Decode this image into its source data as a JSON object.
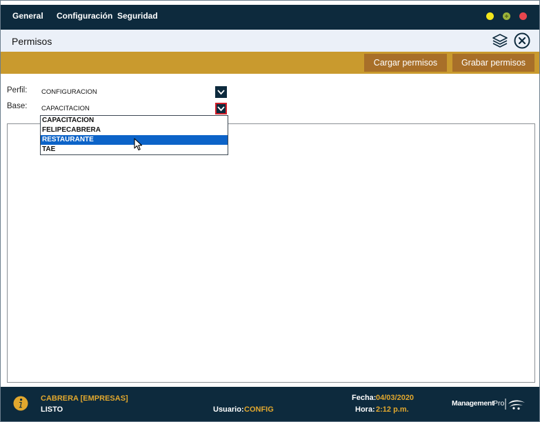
{
  "menu": {
    "items": [
      "General",
      "Configuración",
      "Seguridad"
    ]
  },
  "window": {
    "title": "Permisos"
  },
  "toolbar": {
    "load_label": "Cargar permisos",
    "save_label": "Grabar permisos"
  },
  "form": {
    "perfil_label": "Perfil:",
    "perfil_value": "CONFIGURACION",
    "base_label": "Base:",
    "base_value": "CAPACITACION",
    "base_options": [
      "CAPACITACION",
      "FELIPECABRERA",
      "RESTAURANTE",
      "TAE"
    ],
    "highlighted_option": "RESTAURANTE"
  },
  "status": {
    "company": "CABRERA [EMPRESAS]",
    "state": "LISTO",
    "user_label": "Usuario:",
    "user_value": "CONFIG",
    "date_label": "Fecha:",
    "date_value": "04/03/2020",
    "time_label": "Hora:",
    "time_value": "2:12 p.m.",
    "brand_a": "Management",
    "brand_b": "Pro"
  },
  "colors": {
    "navy": "#0d2a3d",
    "gold": "#c99a2e",
    "button_brown": "#a86f29",
    "selection_blue": "#0c63c8",
    "window_dot_yellow": "#f3e61c",
    "window_dot_green": "#9bb33a",
    "window_dot_red": "#e8464e"
  },
  "icons": [
    "layers-icon",
    "close-circle-icon",
    "chevron-down-icon",
    "info-icon",
    "pointer-cursor-icon",
    "brand-logo"
  ]
}
